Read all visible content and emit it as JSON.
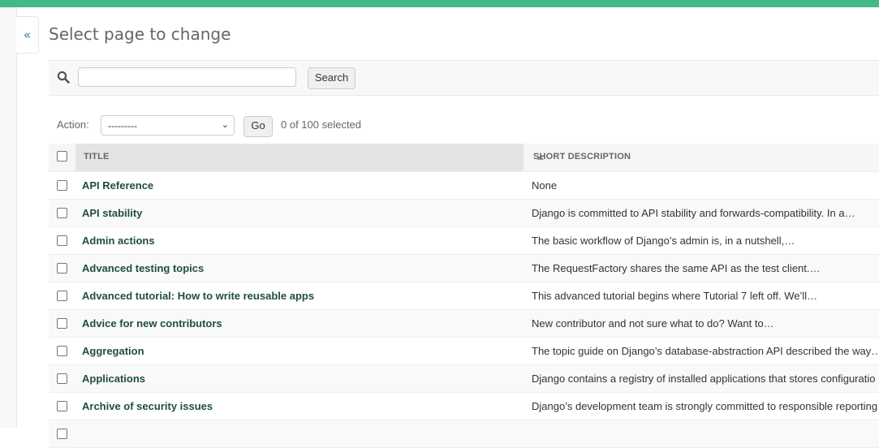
{
  "colors": {
    "header_bar": "#44b78b",
    "link": "#1f4f3a"
  },
  "sidebar": {
    "collapse_label": "«"
  },
  "page": {
    "title": "Select page to change"
  },
  "search": {
    "placeholder": "",
    "value": "",
    "button_label": "Search",
    "icon": "search-icon"
  },
  "actions": {
    "label": "Action:",
    "selected_option": "---------",
    "go_label": "Go",
    "selected_count": "0 of 100 selected"
  },
  "table": {
    "columns": [
      "Title",
      "Short description"
    ],
    "sorted_column": "Title",
    "sort_direction": "ascending",
    "rows": [
      {
        "title": "API Reference",
        "description": "None"
      },
      {
        "title": "API stability",
        "description": "Django is committed to API stability and forwards-compatibility. In a…"
      },
      {
        "title": "Admin actions",
        "description": "The basic workflow of Django’s admin is, in a nutshell,…"
      },
      {
        "title": "Advanced testing topics",
        "description": "The RequestFactory shares the same API as the test client.…"
      },
      {
        "title": "Advanced tutorial: How to write reusable apps",
        "description": "This advanced tutorial begins where Tutorial 7 left off. We’ll…"
      },
      {
        "title": "Advice for new contributors",
        "description": "New contributor and not sure what to do? Want to…"
      },
      {
        "title": "Aggregation",
        "description": "The topic guide on Django’s database-abstraction API described the way…"
      },
      {
        "title": "Applications",
        "description": "Django contains a registry of installed applications that stores configuratio"
      },
      {
        "title": "Archive of security issues",
        "description": "Django’s development team is strongly committed to responsible reporting"
      }
    ]
  }
}
